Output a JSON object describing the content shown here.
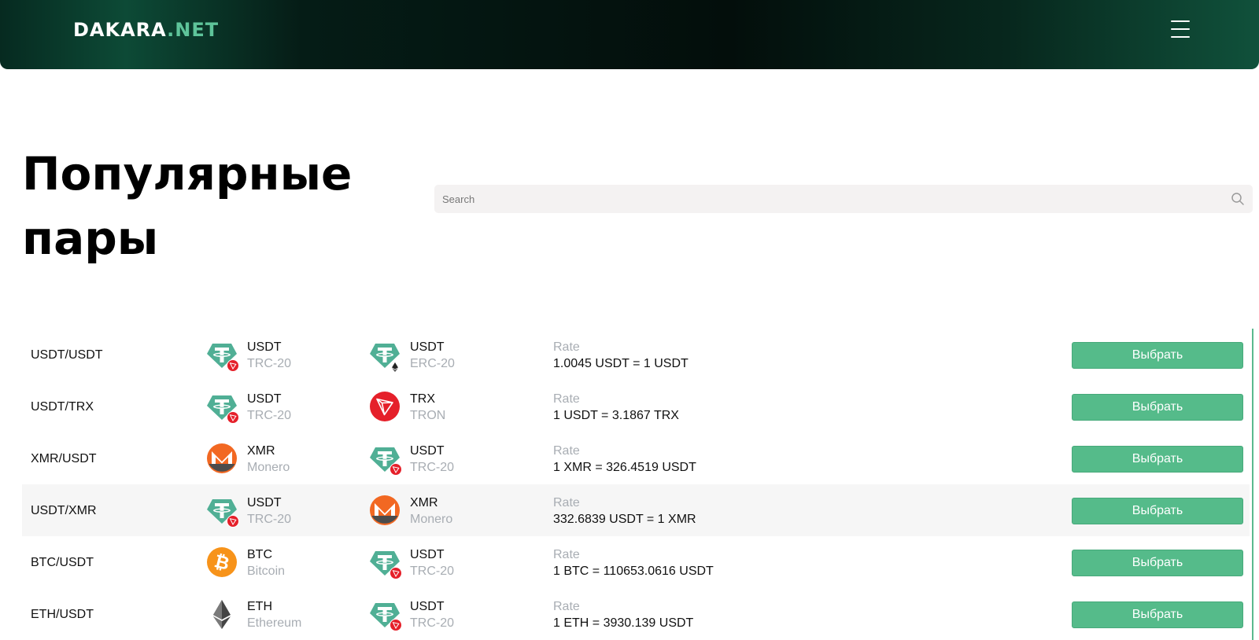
{
  "header": {
    "logo_main": "DAKARA",
    "logo_accent": ".NET"
  },
  "title": {
    "line1": "Популярные",
    "line2": "пары"
  },
  "search": {
    "placeholder": "Search"
  },
  "colors": {
    "accent_green": "#55bb8a",
    "tether_green": "#50af95",
    "tron_red": "#e5202a",
    "monero_orange": "#f26822",
    "bitcoin_orange": "#f7931a"
  },
  "rows": [
    {
      "pair": "USDT/USDT",
      "from": {
        "symbol": "USDT",
        "network": "TRC-20",
        "icon": "tether-icon",
        "badge": "tron-badge-icon"
      },
      "to": {
        "symbol": "USDT",
        "network": "ERC-20",
        "icon": "tether-icon",
        "badge": "ethereum-badge-icon"
      },
      "rate_label": "Rate",
      "rate": "1.0045 USDT = 1 USDT",
      "button": "Выбрать"
    },
    {
      "pair": "USDT/TRX",
      "from": {
        "symbol": "USDT",
        "network": "TRC-20",
        "icon": "tether-icon",
        "badge": "tron-badge-icon"
      },
      "to": {
        "symbol": "TRX",
        "network": "TRON",
        "icon": "tron-icon"
      },
      "rate_label": "Rate",
      "rate": "1 USDT = 3.1867 TRX",
      "button": "Выбрать"
    },
    {
      "pair": "XMR/USDT",
      "from": {
        "symbol": "XMR",
        "network": "Monero",
        "icon": "monero-icon"
      },
      "to": {
        "symbol": "USDT",
        "network": "TRC-20",
        "icon": "tether-icon",
        "badge": "tron-badge-icon"
      },
      "rate_label": "Rate",
      "rate": "1 XMR = 326.4519 USDT",
      "button": "Выбрать"
    },
    {
      "pair": "USDT/XMR",
      "from": {
        "symbol": "USDT",
        "network": "TRC-20",
        "icon": "tether-icon",
        "badge": "tron-badge-icon"
      },
      "to": {
        "symbol": "XMR",
        "network": "Monero",
        "icon": "monero-icon"
      },
      "rate_label": "Rate",
      "rate": "332.6839 USDT = 1 XMR",
      "button": "Выбрать"
    },
    {
      "pair": "BTC/USDT",
      "from": {
        "symbol": "BTC",
        "network": "Bitcoin",
        "icon": "bitcoin-icon"
      },
      "to": {
        "symbol": "USDT",
        "network": "TRC-20",
        "icon": "tether-icon",
        "badge": "tron-badge-icon"
      },
      "rate_label": "Rate",
      "rate": "1 BTC = 110653.0616 USDT",
      "button": "Выбрать"
    },
    {
      "pair": "ETH/USDT",
      "from": {
        "symbol": "ETH",
        "network": "Ethereum",
        "icon": "ethereum-icon"
      },
      "to": {
        "symbol": "USDT",
        "network": "TRC-20",
        "icon": "tether-icon",
        "badge": "tron-badge-icon"
      },
      "rate_label": "Rate",
      "rate": "1 ETH = 3930.139 USDT",
      "button": "Выбрать"
    }
  ]
}
